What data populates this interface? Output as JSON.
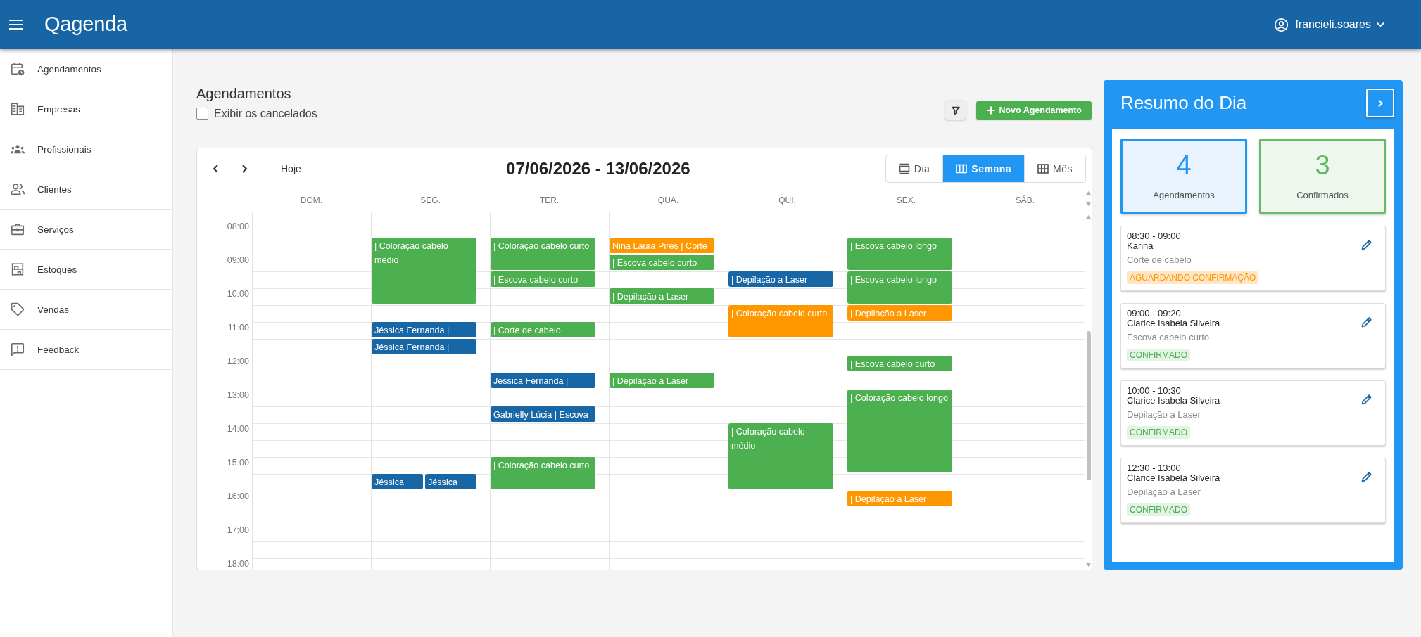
{
  "topbar": {
    "logo": "Qagenda",
    "user": "francieli.soares"
  },
  "sidebar": {
    "items": [
      "Agendamentos",
      "Empresas",
      "Profissionais",
      "Clientes",
      "Serviços",
      "Estoques",
      "Vendas",
      "Feedback"
    ]
  },
  "page": {
    "title": "Agendamentos",
    "show_cancelled": {
      "label": "Exibir os cancelados",
      "checked": false
    },
    "new_button": "Novo Agendamento"
  },
  "calendar": {
    "today_button": "Hoje",
    "range": "07/06/2026 - 13/06/2026",
    "views": [
      {
        "label": "Dia",
        "selected": false
      },
      {
        "label": "Semana",
        "selected": true
      },
      {
        "label": "Mês",
        "selected": false
      }
    ],
    "hours": [
      "08:00",
      "09:00",
      "10:00",
      "11:00",
      "12:00",
      "13:00",
      "14:00",
      "15:00",
      "16:00",
      "17:00",
      "18:00"
    ],
    "days": [
      {
        "label": "DOM."
      },
      {
        "label": "SEG.",
        "slots": [
          {
            "kind": "free"
          },
          {
            "kind": "start",
            "events": [
              {
                "title": "| Coloração cabelo médio",
                "color": "#4caf50"
              }
            ]
          },
          {
            "kind": "cont"
          },
          {
            "kind": "cont"
          },
          {
            "kind": "cont"
          },
          {
            "kind": "free"
          },
          {
            "kind": "start",
            "events": [
              {
                "title": "Jéssica Fernanda |",
                "color": "#1766a5"
              }
            ]
          },
          {
            "kind": "start",
            "events": [
              {
                "title": "Jéssica Fernanda |",
                "color": "#1766a5"
              }
            ]
          },
          {
            "kind": "free"
          },
          {
            "kind": "free"
          },
          {
            "kind": "free"
          },
          {
            "kind": "free"
          },
          {
            "kind": "free"
          },
          {
            "kind": "free"
          },
          {
            "kind": "free"
          },
          {
            "kind": "start",
            "events": [
              {
                "title": "Jéssica",
                "color": "#1766a5"
              },
              {
                "title": "Jéssica",
                "color": "#1766a5"
              }
            ]
          }
        ]
      },
      {
        "label": "TER.",
        "slots": [
          {
            "kind": "free"
          },
          {
            "kind": "start",
            "events": [
              {
                "title": "| Coloração cabelo curto",
                "color": "#4caf50"
              }
            ]
          },
          {
            "kind": "cont"
          },
          {
            "kind": "start",
            "events": [
              {
                "title": "| Escova cabelo curto",
                "color": "#4caf50"
              }
            ]
          },
          {
            "kind": "free"
          },
          {
            "kind": "free"
          },
          {
            "kind": "start",
            "events": [
              {
                "title": "| Corte de cabelo",
                "color": "#4caf50"
              }
            ]
          },
          {
            "kind": "free"
          },
          {
            "kind": "free"
          },
          {
            "kind": "start",
            "events": [
              {
                "title": "Jéssica Fernanda |",
                "color": "#1766a5"
              }
            ]
          },
          {
            "kind": "free"
          },
          {
            "kind": "start",
            "events": [
              {
                "title": "Gabrielly Lúcia | Escova",
                "color": "#1766a5"
              }
            ]
          },
          {
            "kind": "free"
          },
          {
            "kind": "free"
          },
          {
            "kind": "start",
            "events": [
              {
                "title": "| Coloração cabelo curto",
                "color": "#4caf50"
              }
            ]
          },
          {
            "kind": "cont"
          }
        ]
      },
      {
        "label": "QUA.",
        "slots": [
          {
            "kind": "free"
          },
          {
            "kind": "start",
            "events": [
              {
                "title": "Nina Laura Pires | Corte",
                "color": "#ff9800"
              }
            ]
          },
          {
            "kind": "start",
            "events": [
              {
                "title": "| Escova cabelo curto",
                "color": "#4caf50"
              }
            ]
          },
          {
            "kind": "free"
          },
          {
            "kind": "start",
            "events": [
              {
                "title": "| Depilação a Laser",
                "color": "#4caf50"
              }
            ]
          },
          {
            "kind": "free"
          },
          {
            "kind": "free"
          },
          {
            "kind": "free"
          },
          {
            "kind": "free"
          },
          {
            "kind": "start",
            "events": [
              {
                "title": "| Depilação a Laser",
                "color": "#4caf50"
              }
            ]
          }
        ]
      },
      {
        "label": "QUI.",
        "slots": [
          {
            "kind": "free"
          },
          {
            "kind": "free"
          },
          {
            "kind": "free"
          },
          {
            "kind": "start",
            "events": [
              {
                "title": "| Depilação a Laser",
                "color": "#1766a5"
              }
            ]
          },
          {
            "kind": "free"
          },
          {
            "kind": "start",
            "events": [
              {
                "title": "| Coloração cabelo curto",
                "color": "#ff9800"
              }
            ]
          },
          {
            "kind": "cont"
          },
          {
            "kind": "free"
          },
          {
            "kind": "free"
          },
          {
            "kind": "free"
          },
          {
            "kind": "free"
          },
          {
            "kind": "free"
          },
          {
            "kind": "start",
            "events": [
              {
                "title": "| Coloração cabelo médio",
                "color": "#4caf50"
              }
            ]
          },
          {
            "kind": "cont"
          },
          {
            "kind": "cont"
          },
          {
            "kind": "cont"
          }
        ]
      },
      {
        "label": "SEX.",
        "slots": [
          {
            "kind": "free"
          },
          {
            "kind": "start",
            "events": [
              {
                "title": "| Escova cabelo longo",
                "color": "#4caf50"
              }
            ]
          },
          {
            "kind": "cont"
          },
          {
            "kind": "start",
            "events": [
              {
                "title": "| Escova cabelo longo",
                "color": "#4caf50"
              }
            ]
          },
          {
            "kind": "cont"
          },
          {
            "kind": "start",
            "events": [
              {
                "title": "| Depilação a Laser",
                "color": "#ff9800"
              }
            ]
          },
          {
            "kind": "free"
          },
          {
            "kind": "free"
          },
          {
            "kind": "start",
            "events": [
              {
                "title": "| Escova cabelo curto",
                "color": "#4caf50"
              }
            ]
          },
          {
            "kind": "free"
          },
          {
            "kind": "start",
            "events": [
              {
                "title": "| Coloração cabelo longo",
                "color": "#4caf50"
              }
            ]
          },
          {
            "kind": "cont"
          },
          {
            "kind": "cont"
          },
          {
            "kind": "cont"
          },
          {
            "kind": "cont"
          },
          {
            "kind": "free"
          },
          {
            "kind": "start",
            "events": [
              {
                "title": "| Depilação a Laser",
                "color": "#ff9800"
              }
            ]
          }
        ]
      },
      {
        "label": "SÁB."
      }
    ]
  },
  "summary": {
    "title": "Resumo do Dia",
    "stats": [
      {
        "value": "4",
        "label": "Agendamentos",
        "kind": "total"
      },
      {
        "value": "3",
        "label": "Confirmados",
        "kind": "confirmed"
      }
    ],
    "appointments": [
      {
        "time": "08:30 - 09:00",
        "client": "Karina",
        "service": "Corte de cabelo",
        "status": {
          "label": "AGUARDANDO CONFIRMAÇÃO",
          "kind": "pending"
        }
      },
      {
        "time": "09:00 - 09:20",
        "client": "Clarice Isabela Silveira",
        "service": "Escova cabelo curto",
        "status": {
          "label": "CONFIRMADO",
          "kind": "confirmed"
        }
      },
      {
        "time": "10:00 - 10:30",
        "client": "Clarice Isabela Silveira",
        "service": "Depilação a Laser",
        "status": {
          "label": "CONFIRMADO",
          "kind": "confirmed"
        }
      },
      {
        "time": "12:30 - 13:00",
        "client": "Clarice Isabela Silveira",
        "service": "Depilação a Laser",
        "status": {
          "label": "CONFIRMADO",
          "kind": "confirmed"
        }
      }
    ]
  }
}
